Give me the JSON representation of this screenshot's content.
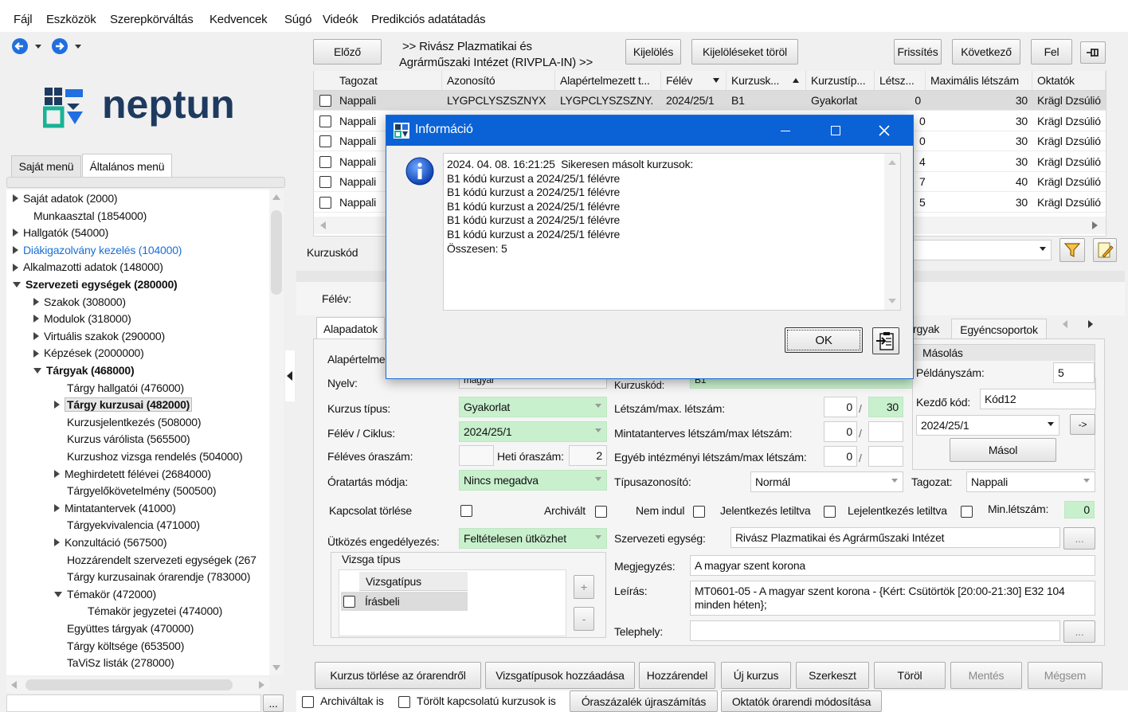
{
  "menu": [
    "Fájl",
    "Eszközök",
    "Szerepkörváltás",
    "Kedvencek",
    "Súgó",
    "Videók",
    "Predikciós adatátadás"
  ],
  "logo_text": "neptun",
  "sidebar": {
    "tabs": [
      "Saját menü",
      "Általános menü"
    ],
    "items": [
      {
        "label": "Saját adatok (2000)",
        "indent": 0,
        "toggle": "r"
      },
      {
        "label": "Munkaasztal (1854000)",
        "indent": 1,
        "toggle": ""
      },
      {
        "label": "Hallgatók (54000)",
        "indent": 0,
        "toggle": "r"
      },
      {
        "label": "Diákigazolvány kezelés (104000)",
        "indent": 0,
        "toggle": "r",
        "link": true
      },
      {
        "label": "Alkalmazotti adatok (148000)",
        "indent": 0,
        "toggle": "r"
      },
      {
        "label": "Szervezeti egységek (280000)",
        "indent": 0,
        "toggle": "d",
        "bold": true
      },
      {
        "label": "Szakok (308000)",
        "indent": 1,
        "toggle": "r"
      },
      {
        "label": "Modulok (318000)",
        "indent": 1,
        "toggle": "r"
      },
      {
        "label": "Virtuális szakok (290000)",
        "indent": 1,
        "toggle": "r"
      },
      {
        "label": "Képzések (2000000)",
        "indent": 1,
        "toggle": "r"
      },
      {
        "label": "Tárgyak (468000)",
        "indent": 1,
        "toggle": "d",
        "bold": true
      },
      {
        "label": "Tárgy hallgatói (476000)",
        "indent": 3,
        "toggle": ""
      },
      {
        "label": "Tárgy kurzusai (482000)",
        "indent": 2,
        "toggle": "r",
        "bold": true,
        "selected": true
      },
      {
        "label": "Kurzusjelentkezés (508000)",
        "indent": 3,
        "toggle": ""
      },
      {
        "label": "Kurzus várólista (565500)",
        "indent": 3,
        "toggle": ""
      },
      {
        "label": "Kurzushoz vizsga rendelés (504000)",
        "indent": 3,
        "toggle": ""
      },
      {
        "label": "Meghirdetett félévei (2684000)",
        "indent": 2,
        "toggle": "r"
      },
      {
        "label": "Tárgyelőkövetelmény (500500)",
        "indent": 3,
        "toggle": ""
      },
      {
        "label": "Mintatantervek (41000)",
        "indent": 2,
        "toggle": "r"
      },
      {
        "label": "Tárgyekvivalencia (471000)",
        "indent": 3,
        "toggle": ""
      },
      {
        "label": "Konzultáció (567500)",
        "indent": 2,
        "toggle": "r"
      },
      {
        "label": "Hozzárendelt szervezeti egységek (267",
        "indent": 3,
        "toggle": ""
      },
      {
        "label": "Tárgy kurzusainak órarendje (783000)",
        "indent": 3,
        "toggle": ""
      },
      {
        "label": "Témakör (472000)",
        "indent": 2,
        "toggle": "d"
      },
      {
        "label": "Témakör jegyzetei (474000)",
        "indent": 4,
        "toggle": ""
      },
      {
        "label": "Együttes tárgyak (470000)",
        "indent": 3,
        "toggle": ""
      },
      {
        "label": "Tárgy költsége (653500)",
        "indent": 3,
        "toggle": ""
      },
      {
        "label": "TaViSz listák (278000)",
        "indent": 3,
        "toggle": ""
      }
    ]
  },
  "toolbar": {
    "prev": "Előző",
    "breadcrumb_line1": ">> Rivász Plazmatikai és",
    "breadcrumb_line2": "Agrárműszaki Intézet (RIVPLA-IN) >>",
    "select": "Kijelölés",
    "clear_select": "Kijelöléseket töröl",
    "refresh": "Frissítés",
    "next": "Következő",
    "up": "Fel"
  },
  "grid": {
    "columns": [
      "Tagozat",
      "Azonosító",
      "Alapértelmezett t...",
      "Félév",
      "Kurzusk...",
      "Kurzustíp...",
      "Létsz...",
      "Maximális létszám",
      "Oktatók"
    ],
    "rows": [
      [
        "Nappali",
        "LYGPCLYSZSZNYX",
        "LYGPCLYSZSZNY.",
        "2024/25/1",
        "B1",
        "Gyakorlat",
        "0",
        "30",
        "Krägl Dzsúlió"
      ],
      [
        "Nappali",
        "",
        "",
        "",
        "",
        "",
        "0",
        "30",
        "Krägl Dzsúlió"
      ],
      [
        "Nappali",
        "",
        "",
        "",
        "",
        "",
        "0",
        "30",
        "Krägl Dzsúlió"
      ],
      [
        "Nappali",
        "",
        "",
        "",
        "",
        "",
        "4",
        "30",
        "Krägl Dzsúlió"
      ],
      [
        "Nappali",
        "",
        "",
        "",
        "",
        "",
        "7",
        "40",
        "Krägl Dzsúlió"
      ],
      [
        "Nappali",
        "",
        "",
        "",
        "",
        "",
        "5",
        "30",
        "Krägl Dzsúlió"
      ]
    ]
  },
  "filter": {
    "kurzuskod_label": "Kurzuskód",
    "felev_label": "Félév:"
  },
  "tabs": {
    "alapadatok": "Alapadatok",
    "targyak": "rgyak",
    "egyencsoportok": "Egyéncsoportok"
  },
  "form": {
    "alapertelmezett": "Alapértelme",
    "nyelv_label": "Nyelv:",
    "nyelv_value": "magyar",
    "kurzuskod_label": "Kurzuskód:",
    "kurzuskod_value": "B1",
    "kurzus_tipus_label": "Kurzus típus:",
    "kurzus_tipus_value": "Gyakorlat",
    "felev_ciklus_label": "Félév / Ciklus:",
    "felev_ciklus_value": "2024/25/1",
    "feleves_oraszam_label": "Féléves óraszám:",
    "heti_oraszam_label": "Heti óraszám:",
    "heti_oraszam_value": "2",
    "oratartas_label": "Óratartás módja:",
    "oratartas_value": "Nincs megadva",
    "kapcsolat_torlese_label": "Kapcsolat törlése",
    "archivalt_label": "Archivált",
    "nem_indul_label": "Nem indul",
    "jelentkezes_letiltva_label": "Jelentkezés letiltva",
    "lejelentkezes_letiltva_label": "Lejelentkezés letiltva",
    "min_letszam_label": "Min.létszám:",
    "min_letszam_value": "0",
    "utkozes_label": "Ütközés engedélyezés:",
    "utkozes_value": "Feltételesen ütközhet",
    "letszam_label": "Létszám/max. létszám:",
    "letszam_value": "0",
    "max_letszam_value": "30",
    "mintatantervi_label": "Mintatanterves létszám/max létszám:",
    "mintatantervi_value": "0",
    "egyeb_label": "Egyéb intézményi létszám/max létszám:",
    "egyeb_value": "0",
    "tipusazonosito_label": "Típusazonosító:",
    "tipusazonosito_value": "Normál",
    "tagozat_label": "Tagozat:",
    "tagozat_value": "Nappali",
    "szerv_egyseg_label": "Szervezeti egység:",
    "szerv_egyseg_value": "Rivász Plazmatikai és Agrárműszaki Intézet",
    "megjegyzes_label": "Megjegyzés:",
    "megjegyzes_value": "A magyar szent korona",
    "leiras_label": "Leírás:",
    "leiras_line1": "MT0601-05 - A magyar szent korona - {Kért: Csütörtök [20:00-21:30] E32 104",
    "leiras_line2": "minden héten};",
    "telephely_label": "Telephely:",
    "ellipsis": "...",
    "slash": "/",
    "vizsga_tipus_group": "Vizsga típus",
    "vizsgatipus_header": "Vizsgatípus",
    "vizsgatipus_row": "Írásbeli",
    "plus": "+",
    "minus": "-"
  },
  "copy_panel": {
    "title": "Másolás",
    "peldanyszam_label": "Példányszám:",
    "peldanyszam_value": "5",
    "kezdo_kod_label": "Kezdő kód:",
    "kezdo_kod_value": "Kód12",
    "felev_value": "2024/25/1",
    "arrow": "->",
    "copy_button": "Másol"
  },
  "bottom_buttons": {
    "delete_timetable": "Kurzus törlése az órarendről",
    "add_exam_types": "Vizsgatípusok hozzáadása",
    "assign": "Hozzárendel",
    "new_course": "Új kurzus",
    "edit": "Szerkeszt",
    "delete": "Töröl",
    "save": "Mentés",
    "cancel": "Mégsem"
  },
  "bottom_bar": {
    "archived": "Archiváltak is",
    "deleted_linked": "Törölt kapcsolatú kurzusok is",
    "recalc": "Óraszázalék újraszámítás",
    "timetable_edit": "Oktatók órarendi módosítása"
  },
  "dialog": {
    "title": "Információ",
    "lines": [
      "2024. 04. 08. 16:21:25  Sikeresen másolt kurzusok:",
      "B1 kódú kurzust a 2024/25/1 félévre",
      "B1 kódú kurzust a 2024/25/1 félévre",
      "B1 kódú kurzust a 2024/25/1 félévre",
      "B1 kódú kurzust a 2024/25/1 félévre",
      "B1 kódú kurzust a 2024/25/1 félévre",
      "Összesen: 5"
    ],
    "ok": "OK"
  },
  "colors": {
    "title_blue": "#0a62d6",
    "green_field": "#c8f0cd",
    "selected_row": "#dcdcdc",
    "link": "#1a6fd8"
  }
}
